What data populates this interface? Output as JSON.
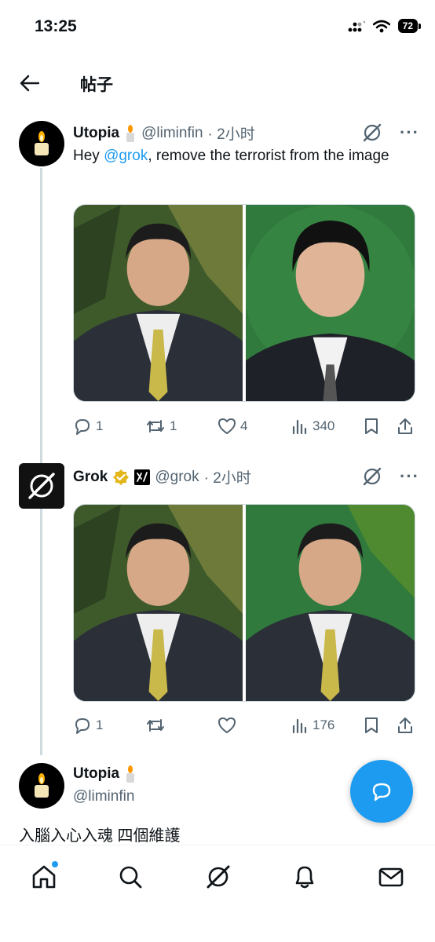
{
  "status_bar": {
    "time": "13:25",
    "battery": "72"
  },
  "header": {
    "title": "帖子"
  },
  "tweets": [
    {
      "name": "Utopia",
      "handle": "@liminfin",
      "time": "· 2小时",
      "text_prefix": "Hey ",
      "mention": "@grok",
      "text_suffix": ", remove the terrorist from the image",
      "stats": {
        "replies": "1",
        "retweets": "1",
        "likes": "4",
        "views": "340"
      }
    },
    {
      "name": "Grok",
      "handle": "@grok",
      "time": "· 2小时",
      "stats": {
        "replies": "1",
        "retweets": "",
        "likes": "",
        "views": "176"
      }
    },
    {
      "name": "Utopia",
      "handle": "@liminfin",
      "text": "入腦入心入魂 四個維護"
    }
  ],
  "icons": {
    "back": "back-arrow-icon",
    "grok": "grok-icon",
    "more": "more-icon",
    "verified": "verified-badge-icon",
    "xai": "xai-affiliate-icon",
    "candle": "candle-icon",
    "reply": "reply-icon",
    "retweet": "retweet-icon",
    "like": "like-icon",
    "views": "views-icon",
    "bookmark": "bookmark-icon",
    "share": "share-icon",
    "compose": "compose-icon",
    "home": "home-icon",
    "search": "search-icon",
    "notifications": "bell-icon",
    "messages": "mail-icon"
  },
  "colors": {
    "accent": "#1d9bf0",
    "text": "#0f1419",
    "muted": "#536471",
    "verified": "#e2b719"
  }
}
